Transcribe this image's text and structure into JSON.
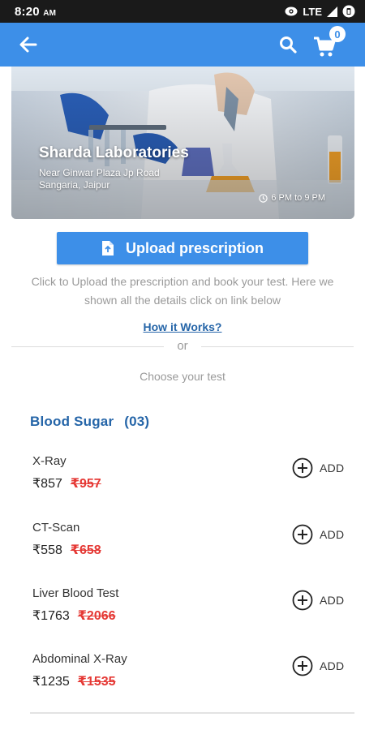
{
  "status_bar": {
    "time": "8:20",
    "ampm": "AM",
    "network": "LTE"
  },
  "app_bar": {
    "cart_count": "0"
  },
  "lab": {
    "name": "Sharda Laboratories",
    "address_line1": "Near Ginwar Plaza Jp Road",
    "address_line2": "Sangaria, Jaipur",
    "hours": "6 PM to 9 PM"
  },
  "upload": {
    "button_label": "Upload prescription",
    "description": "Click to Upload the prescription and book your test. Here we shown all the details click on link below",
    "how_it_works": "How it Works?",
    "or_text": "or",
    "choose_text": "Choose your test"
  },
  "category": {
    "name": "Blood Sugar",
    "count": "(03)"
  },
  "tests": [
    {
      "name": "X-Ray",
      "price": "₹857",
      "old_price": "₹957",
      "add_label": "ADD"
    },
    {
      "name": "CT-Scan",
      "price": "₹558",
      "old_price": "₹658",
      "add_label": "ADD"
    },
    {
      "name": "Liver Blood Test",
      "price": "₹1763",
      "old_price": "₹2066",
      "add_label": "ADD"
    },
    {
      "name": "Abdominal X-Ray",
      "price": "₹1235",
      "old_price": "₹1535",
      "add_label": "ADD"
    }
  ],
  "colors": {
    "primary": "#3d8fe8",
    "link": "#2565a8",
    "strike_price": "#e53935"
  },
  "icons": [
    "eye-icon",
    "signal-icon",
    "battery-icon",
    "back-arrow-icon",
    "search-icon",
    "cart-icon",
    "clock-icon",
    "document-icon",
    "plus-circle-icon"
  ]
}
